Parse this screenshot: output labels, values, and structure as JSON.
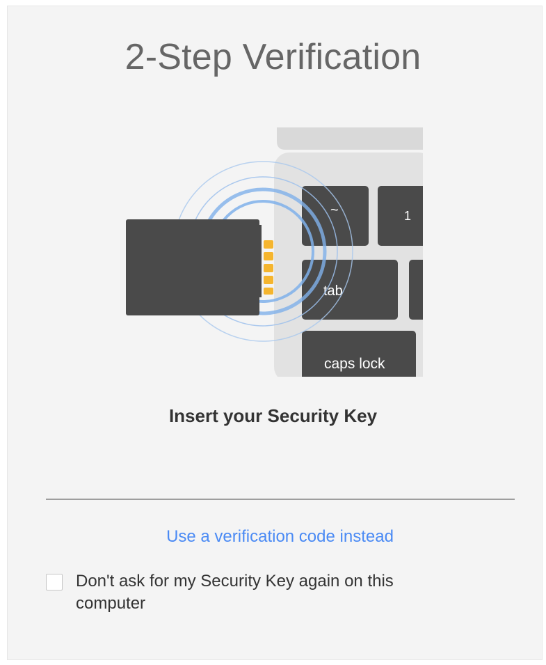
{
  "title": "2-Step Verification",
  "illustration": {
    "keys": {
      "tilde": "~",
      "one": "1",
      "tab": "tab",
      "caps": "caps lock"
    }
  },
  "instruction": "Insert your Security Key",
  "alternative_link": "Use a verification code instead",
  "remember_checkbox": {
    "checked": false,
    "label": "Don't ask for my Security Key again on this computer"
  },
  "colors": {
    "accent": "#4a8af4",
    "key_body": "#4a4a4a",
    "contacts": "#f5b52e",
    "ring": "#7fb0ea"
  }
}
